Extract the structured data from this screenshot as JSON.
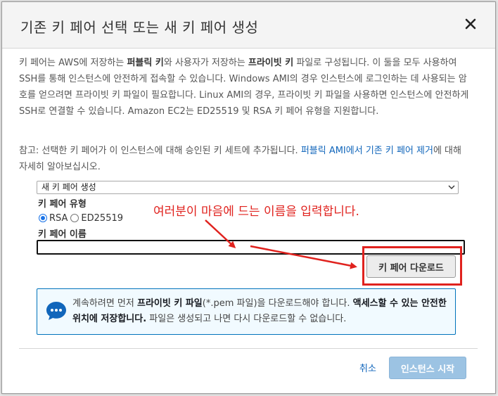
{
  "modal": {
    "title": "기존 키 페어 선택 또는 새 키 페어 생성"
  },
  "description": {
    "p1_a": "키 페어는 AWS에 저장하는 ",
    "p1_b": "퍼블릭 키",
    "p1_c": "와 사용자가 저장하는 ",
    "p1_d": "프라이빗 키",
    "p1_e": " 파일로 구성됩니다. 이 둘을 모두 사용하여 SSH를 통해 인스턴스에 안전하게 접속할 수 있습니다. Windows AMI의 경우 인스턴스에 로그인하는 데 사용되는 암호를 얻으려면 프라이빗 키 파일이 필요합니다. Linux AMI의 경우, 프라이빗 키 파일을 사용하면 인스턴스에 안전하게 SSH로 연결할 수 있습니다. Amazon EC2는 ED25519 및 RSA 키 페어 유형을 지원합니다."
  },
  "note": {
    "prefix": "참고: 선택한 키 페어가 이 인스턴스에 대해 승인된 키 세트에 추가됩니다. ",
    "link": "퍼블릭 AMI에서 기존 키 페어 제거",
    "suffix": "에 대해 자세히 알아보십시오."
  },
  "form": {
    "select_value": "새 키 페어 생성",
    "key_type_label": "키 페어 유형",
    "rsa_label": "RSA",
    "ed_label": "ED25519",
    "key_type_selected": "RSA",
    "name_label": "키 페어 이름",
    "name_value": "",
    "download_button": "키 페어 다운로드"
  },
  "annotation": {
    "text": "여러분이 마음에 드는 이름을 입력합니다.",
    "color": "#e0221e"
  },
  "info": {
    "t1": "계속하려면 먼저 ",
    "t2": "프라이빗 키 파일",
    "t3": "(*.pem 파일)을 다운로드해야 합니다. ",
    "t4": "액세스할 수 있는 안전한 위치에 저장합니다.",
    "t5": " 파일은 생성되고 나면 다시 다운로드할 수 없습니다.",
    "icon": "chat-bubble-icon"
  },
  "footer": {
    "cancel": "취소",
    "launch": "인스턴스 시작"
  },
  "colors": {
    "link": "#1166bb",
    "info_border": "#0073bb",
    "launch_disabled": "#9cc3e3"
  }
}
